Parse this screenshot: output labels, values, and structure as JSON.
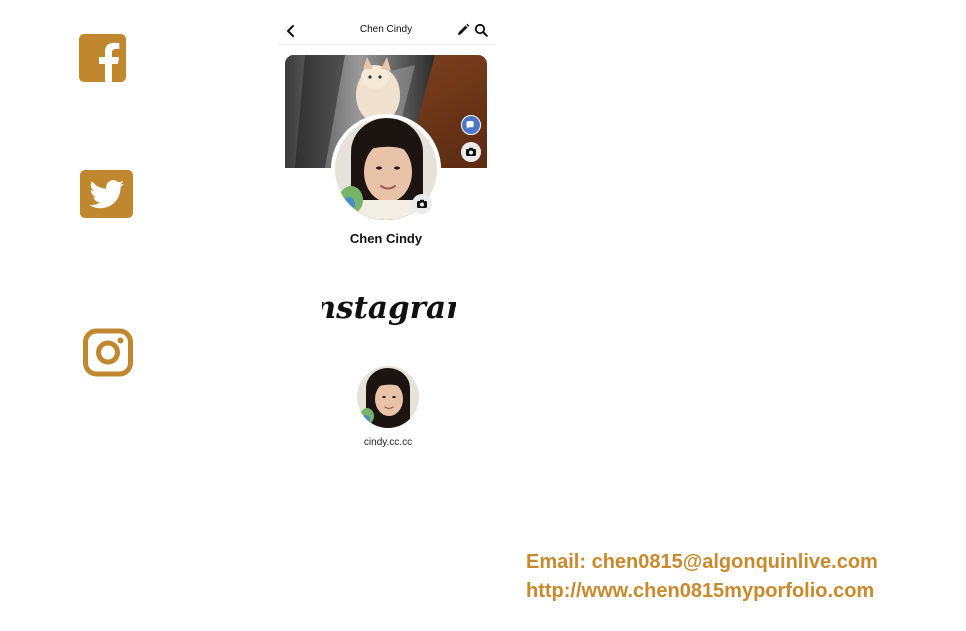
{
  "colors": {
    "brand_gold": "#c0872f",
    "contact_text": "#c98a2e",
    "fb_accent": "#4e76c8"
  },
  "social_icons": [
    {
      "name": "facebook-icon"
    },
    {
      "name": "twitter-icon"
    },
    {
      "name": "instagram-icon"
    }
  ],
  "facebook_profile": {
    "header_title": "Chen Cindy",
    "profile_name": "Chen Cindy"
  },
  "instagram_profile": {
    "logo_text": "Instagram",
    "username": "cindy.cc.cc"
  },
  "contact": {
    "email": "Email: chen0815@algonquinlive.com",
    "website": "http://www.chen0815myporfolio.com"
  }
}
